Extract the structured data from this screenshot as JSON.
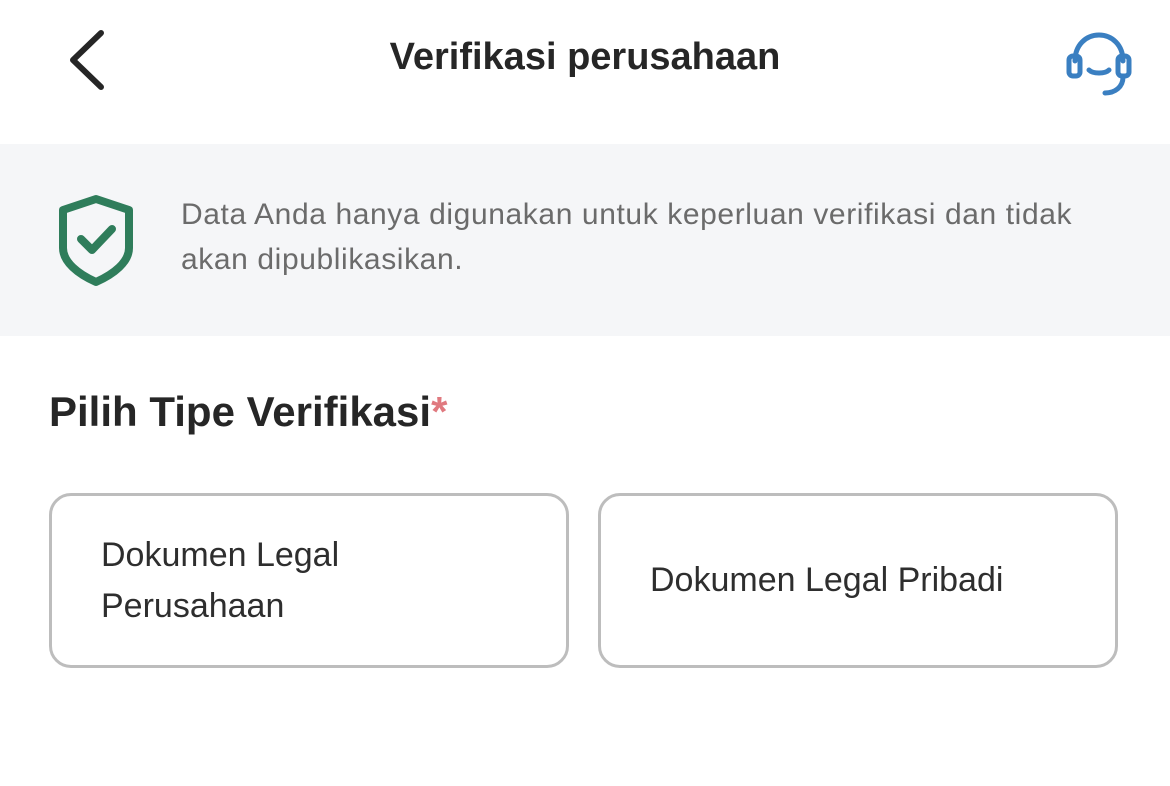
{
  "header": {
    "title": "Verifikasi perusahaan",
    "back_icon": "chevron-left-icon",
    "support_icon": "headset-icon",
    "support_color": "#3a7fc1"
  },
  "banner": {
    "icon": "shield-check-icon",
    "icon_color": "#2f7d5b",
    "text": "Data Anda hanya digunakan untuk keperluan verifikasi dan tidak akan dipublikasikan."
  },
  "section": {
    "title": "Pilih Tipe Verifikasi",
    "required_mark": "*",
    "required_color": "#e0797f",
    "options": [
      {
        "label": "Dokumen Legal Perusahaan"
      },
      {
        "label": "Dokumen Legal Pribadi"
      }
    ]
  }
}
